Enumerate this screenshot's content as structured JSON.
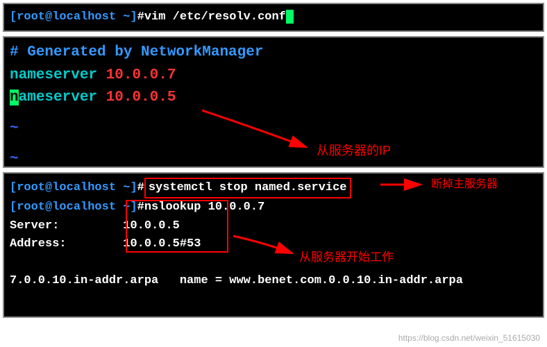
{
  "block1": {
    "prompt_user": "root",
    "prompt_host": "localhost",
    "prompt_path": "~",
    "command": "vim /etc/resolv.conf"
  },
  "block2": {
    "comment_line": "# Generated by NetworkManager",
    "ns1_key": "nameserver",
    "ns1_ip": "10.0.0.7",
    "ns2_first_char": "n",
    "ns2_rest": "ameserver",
    "ns2_ip": "10.0.0.5",
    "tilde1": "~",
    "tilde2": "~",
    "annotation1": "从服务器的IP"
  },
  "block3": {
    "prompt_user": "root",
    "prompt_host": "localhost",
    "prompt_path": "~",
    "cmd1": "systemctl stop named.service",
    "cmd2": "nslookup 10.0.0.7",
    "server_label": "Server:",
    "server_value": "10.0.0.5",
    "address_label": "Address:",
    "address_value": "10.0.0.5#53",
    "result_left": "7.0.0.10.in-addr.arpa",
    "result_mid": "name = ",
    "result_right": "www.benet.com.0.0.10.in-addr.arpa",
    "annotation2": "断掉主服务器",
    "annotation3": "从服务器开始工作"
  },
  "watermark": "https://blog.csdn.net/weixin_51615030"
}
